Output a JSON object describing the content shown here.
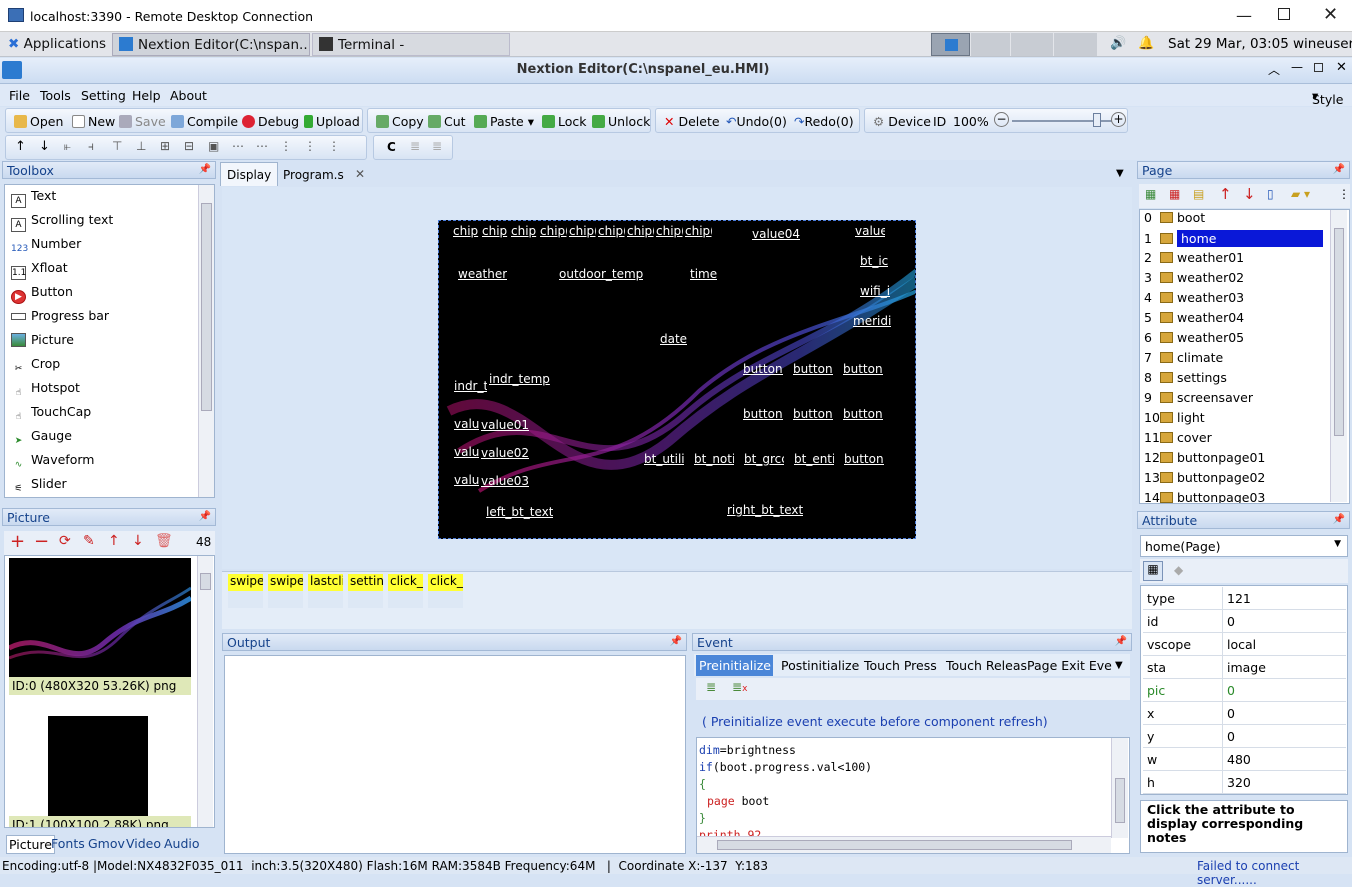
{
  "rdp": {
    "title": "localhost:3390 - Remote Desktop Connection"
  },
  "taskbar": {
    "applications": "Applications",
    "task_editor": "Nextion Editor(C:\\nspan...",
    "task_terminal": "Terminal -",
    "clock": "Sat 29 Mar, 03:05",
    "user": "wineuser"
  },
  "app": {
    "title": "Nextion Editor(C:\\nspanel_eu.HMI)",
    "style_label": "Style"
  },
  "menu": [
    "File",
    "Tools",
    "Setting",
    "Help",
    "About"
  ],
  "toolbar": {
    "open": "Open",
    "new": "New",
    "save": "Save",
    "compile": "Compile",
    "debug": "Debug",
    "upload": "Upload",
    "copy": "Copy",
    "cut": "Cut",
    "paste": "Paste",
    "lock": "Lock",
    "unlock": "Unlock",
    "delete": "Delete",
    "undo": "Undo(0)",
    "redo": "Redo(0)",
    "device": "Device",
    "id": "ID",
    "zoom": "100%",
    "font_btn": "C",
    "zoom_level": 0.85
  },
  "toolbox": {
    "title": "Toolbox",
    "items": [
      "Text",
      "Scrolling text",
      "Number",
      "Xfloat",
      "Button",
      "Progress bar",
      "Picture",
      "Crop",
      "Hotspot",
      "TouchCap",
      "Gauge",
      "Waveform",
      "Slider"
    ]
  },
  "picture_panel": {
    "title": "Picture",
    "count": "48",
    "items": [
      {
        "caption": "ID:0  (480X320 53.26K) png"
      },
      {
        "caption": "ID:1  (100X100 2.88K) png"
      }
    ],
    "tabs": [
      "Picture",
      "Fonts",
      "Gmov",
      "Video",
      "Audio"
    ]
  },
  "tabs": {
    "display": "Display",
    "program": "Program.s"
  },
  "canvas_labels": {
    "chip1": "chip",
    "chip2": "chip",
    "chip3": "chip",
    "chip4": "chip(",
    "chip5": "chip(",
    "chip6": "chip(",
    "chip7": "chip(",
    "chip8": "chip(",
    "chip9": "chip(",
    "value04": "value04",
    "value_tr": "value",
    "bt_ic": "bt_ic",
    "wifi_i": "wifi_i",
    "meridi": "meridi",
    "weather": "weather",
    "outdoor_temp": "outdoor_temp",
    "time": "time",
    "date": "date",
    "indr_t": "indr_t",
    "indr_temp": "indr_temp",
    "valu1": "valu",
    "value01": "value01",
    "valu2": "valu",
    "value02": "value02",
    "valu3": "valu",
    "value03": "value03",
    "button_r1a": "button(",
    "button_r1b": "button(",
    "button_r1c": "button(",
    "button_r2a": "button(",
    "button_r2b": "button(",
    "button_r2c": "button(",
    "bt_utili": "bt_utili",
    "bt_noti": "bt_noti",
    "bt_grcc": "bt_grcc",
    "bt_enti": "bt_enti",
    "button_r3c": "button(",
    "left_bt_text": "left_bt_text",
    "right_bt_text": "right_bt_text"
  },
  "timers": [
    "swipe",
    "swipe",
    "lastcli",
    "settin",
    "click_",
    "click_t"
  ],
  "output": {
    "title": "Output"
  },
  "event": {
    "title": "Event",
    "tabs": [
      "Preinitialize E",
      "Postinitialize",
      "Touch Press",
      "Touch Releas",
      "Page Exit Eve"
    ],
    "note": "( Preinitialize event execute before component refresh)",
    "code": [
      {
        "kw": "dim",
        "rest": "=brightness"
      },
      {
        "kw": "if",
        "rest": "(boot.progress.val<100)"
      },
      {
        "kw": "",
        "rest": "{"
      },
      {
        "kw": "page",
        "rest": " boot"
      },
      {
        "kw": "",
        "rest": "}"
      },
      {
        "kw": "",
        "rest": "printh 92"
      }
    ]
  },
  "page_panel": {
    "title": "Page",
    "pages": [
      {
        "n": "0",
        "name": "boot"
      },
      {
        "n": "1",
        "name": "home"
      },
      {
        "n": "2",
        "name": "weather01"
      },
      {
        "n": "3",
        "name": "weather02"
      },
      {
        "n": "4",
        "name": "weather03"
      },
      {
        "n": "5",
        "name": "weather04"
      },
      {
        "n": "6",
        "name": "weather05"
      },
      {
        "n": "7",
        "name": "climate"
      },
      {
        "n": "8",
        "name": "settings"
      },
      {
        "n": "9",
        "name": "screensaver"
      },
      {
        "n": "10",
        "name": "light"
      },
      {
        "n": "11",
        "name": "cover"
      },
      {
        "n": "12",
        "name": "buttonpage01"
      },
      {
        "n": "13",
        "name": "buttonpage02"
      },
      {
        "n": "14",
        "name": "buttonpage03"
      }
    ],
    "selected": "home"
  },
  "attribute": {
    "title": "Attribute",
    "selector": "home(Page)",
    "rows": [
      {
        "k": "type",
        "v": "121"
      },
      {
        "k": "id",
        "v": "0"
      },
      {
        "k": "vscope",
        "v": "local"
      },
      {
        "k": "sta",
        "v": "image"
      },
      {
        "k": "pic",
        "v": "0"
      },
      {
        "k": "x",
        "v": "0"
      },
      {
        "k": "y",
        "v": "0"
      },
      {
        "k": "w",
        "v": "480"
      },
      {
        "k": "h",
        "v": "320"
      }
    ],
    "note": "Click the attribute to display corresponding notes"
  },
  "status": {
    "left": "Encoding:utf-8 |Model:NX4832F035_011  inch:3.5(320X480) Flash:16M RAM:3584B Frequency:64M   |  Coordinate X:-137  Y:183",
    "right": "Failed to connect server......"
  },
  "colors": {
    "accent": "#0000ee",
    "panel_title": "#15428b",
    "timer": "#ffff33",
    "status_error": "#1a3fb0"
  }
}
